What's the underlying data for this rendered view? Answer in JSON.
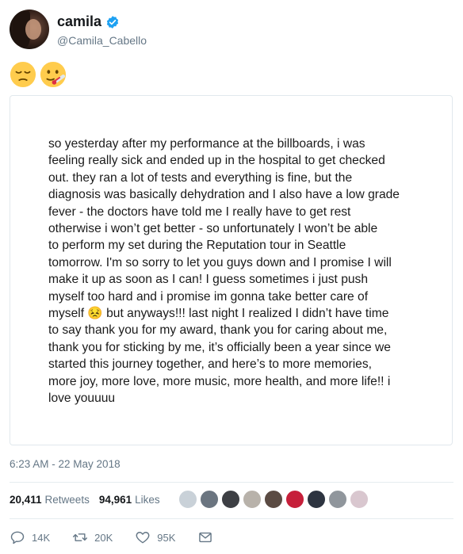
{
  "user": {
    "display_name": "camila",
    "handle": "@Camila_Cabello",
    "verified": true
  },
  "tweet": {
    "emojis": [
      "pensive-face",
      "face-with-thermometer"
    ],
    "note_text": "so yesterday after my performance at the billboards, i was\nfeeling really sick and ended up in the hospital to get checked\nout. they ran a lot of tests and everything is fine, but the\ndiagnosis was basically dehydration and I also have a low grade\nfever - the doctors have told me I really have to get rest\notherwise i won’t get better - so unfortunately I won’t be able\nto perform my set during the Reputation tour in Seattle\ntomorrow. I'm so sorry to let you guys down and I promise I will\nmake it up as soon as I can! I guess sometimes i just push\nmyself too hard and i promise im gonna take better care of\nmyself 😣 but anyways!!!  last night I realized I didn’t have time\nto say thank you for my award, thank you for caring about me,\nthank you for sticking by me, it’s officially been a year since we\nstarted this journey together, and here’s to more memories,\nmore joy, more love, more music, more health, and more life!! i\nlove youuuu",
    "timestamp": "6:23 AM - 22 May 2018"
  },
  "stats": {
    "retweets_count": "20,411",
    "retweets_label": "Retweets",
    "likes_count": "94,961",
    "likes_label": "Likes"
  },
  "liker_avatars": [
    "#c9d1d8",
    "#6b7580",
    "#3d3f44",
    "#b8b2aa",
    "#5b4b43",
    "#c61f3a",
    "#2d3440",
    "#90969c",
    "#d9c7cf"
  ],
  "actions": {
    "reply_count": "14K",
    "retweet_count": "20K",
    "like_count": "95K"
  },
  "colors": {
    "verified_blue": "#1da1f2",
    "muted_text": "#657786",
    "divider": "#e6ecf0"
  }
}
